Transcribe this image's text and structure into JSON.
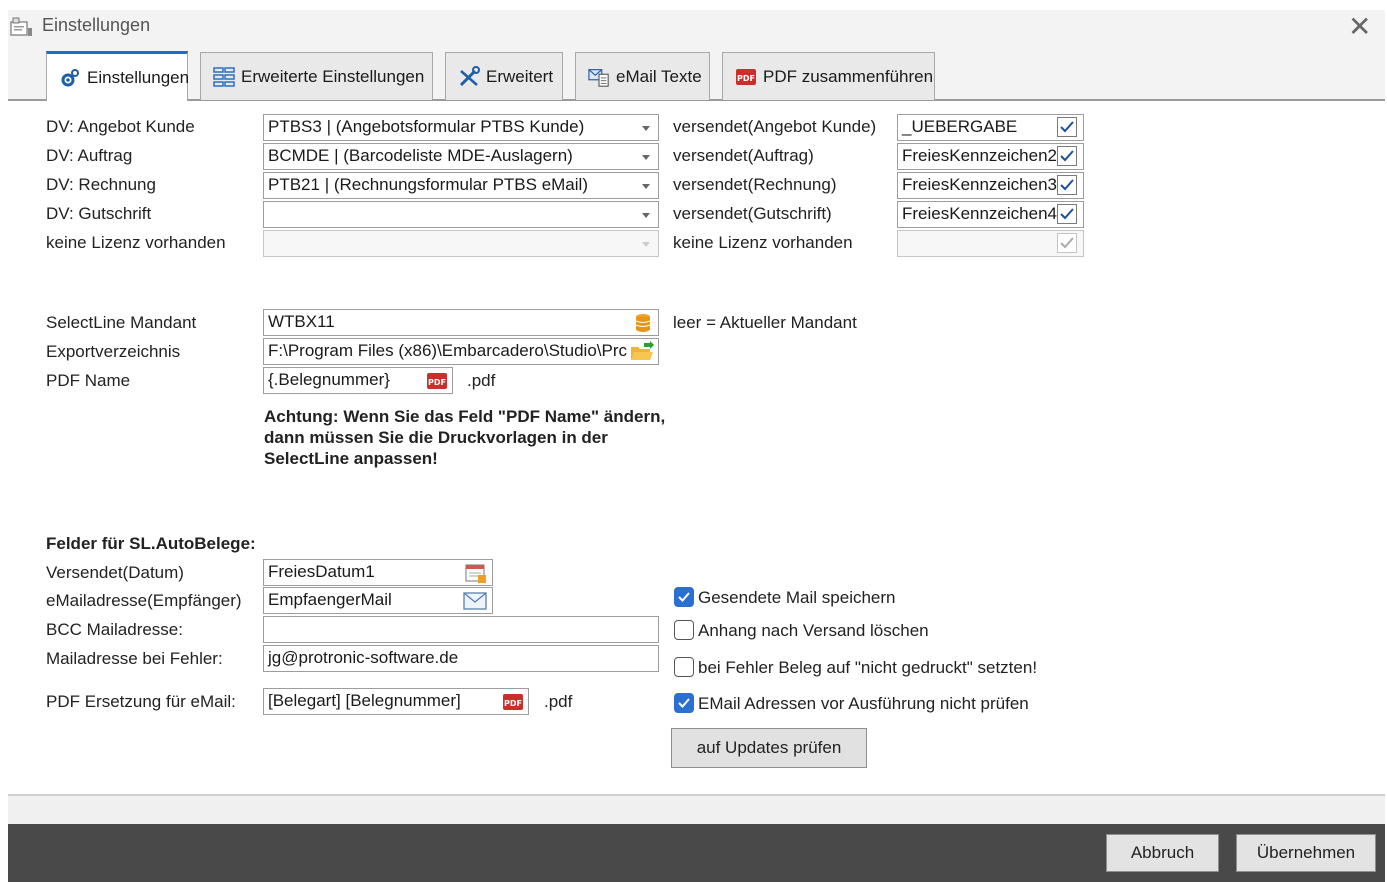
{
  "window": {
    "title": "Einstellungen",
    "close_icon": "close-icon"
  },
  "tabs": [
    {
      "label": "Einstellungen",
      "icon": "gears-icon",
      "active": true
    },
    {
      "label": "Erweiterte Einstellungen",
      "icon": "grid-icon",
      "active": false
    },
    {
      "label": "Erweitert",
      "icon": "tools-icon",
      "active": false
    },
    {
      "label": "eMail Texte",
      "icon": "email-template-icon",
      "active": false
    },
    {
      "label": "PDF zusammenführen",
      "icon": "pdf-icon",
      "active": false
    }
  ],
  "dv_rows": [
    {
      "label": "DV: Angebot Kunde",
      "value": "PTBS3 | (Angebotsformular PTBS Kunde)",
      "versendet_label": "versendet(Angebot Kunde)",
      "versendet_value": "_UEBERGABE",
      "checked": true,
      "enabled": true
    },
    {
      "label": "DV: Auftrag",
      "value": "BCMDE | (Barcodeliste MDE-Auslagern)",
      "versendet_label": "versendet(Auftrag)",
      "versendet_value": "FreiesKennzeichen2",
      "checked": true,
      "enabled": true
    },
    {
      "label": "DV: Rechnung",
      "value": "PTB21 | (Rechnungsformular PTBS eMail)",
      "versendet_label": "versendet(Rechnung)",
      "versendet_value": "FreiesKennzeichen3",
      "checked": true,
      "enabled": true
    },
    {
      "label": "DV: Gutschrift",
      "value": "",
      "versendet_label": "versendet(Gutschrift)",
      "versendet_value": "FreiesKennzeichen4",
      "checked": true,
      "enabled": true
    },
    {
      "label": "keine Lizenz vorhanden",
      "value": "",
      "versendet_label": "keine Lizenz vorhanden",
      "versendet_value": "",
      "checked": true,
      "enabled": false
    }
  ],
  "mandant": {
    "label": "SelectLine Mandant",
    "value": "WTBX11",
    "hint": "leer = Aktueller Mandant"
  },
  "export": {
    "label": "Exportverzeichnis",
    "value": "F:\\Program Files (x86)\\Embarcadero\\Studio\\Prc"
  },
  "pdf_name": {
    "label": "PDF Name",
    "value": "{.Belegnummer}",
    "suffix": ".pdf"
  },
  "warning": "Achtung: Wenn Sie das Feld \"PDF Name\" ändern, dann müssen Sie die Druckvorlagen in der SelectLine anpassen!",
  "autobelege": {
    "heading": "Felder für SL.AutoBelege:",
    "versendet_datum_label": "Versendet(Datum)",
    "versendet_datum_value": "FreiesDatum1",
    "email_label": "eMailadresse(Empfänger)",
    "email_value": "EmpfaengerMail",
    "bcc_label": "BCC Mailadresse:",
    "bcc_value": "",
    "error_mail_label": "Mailadresse bei Fehler:",
    "error_mail_value": "jg@protronic-software.de",
    "pdf_ersetzung_label": "PDF Ersetzung für eMail:",
    "pdf_ersetzung_value": "[Belegart] [Belegnummer]",
    "pdf_ersetzung_suffix": ".pdf"
  },
  "options": [
    {
      "label": "Gesendete Mail speichern",
      "checked": true
    },
    {
      "label": "Anhang nach Versand löschen",
      "checked": false
    },
    {
      "label": "bei Fehler Beleg auf \"nicht gedruckt\" setzten!",
      "checked": false
    },
    {
      "label": "EMail Adressen vor Ausführung nicht prüfen",
      "checked": true
    }
  ],
  "buttons": {
    "updates": "auf Updates prüfen",
    "cancel": "Abbruch",
    "apply": "Übernehmen"
  },
  "colors": {
    "accent": "#1c6ec2",
    "checkbox_blue": "#2b6fd0",
    "footer_dark": "#4a4949"
  }
}
